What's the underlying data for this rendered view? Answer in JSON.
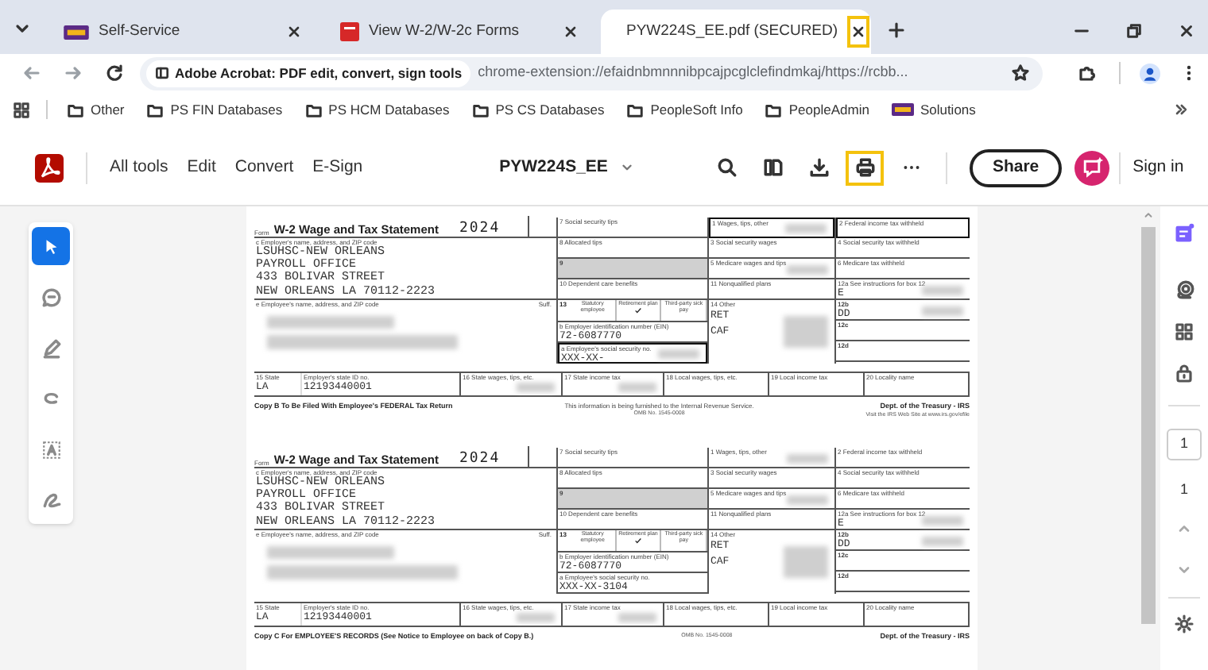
{
  "tabs": [
    {
      "label": "Self-Service",
      "kind": "logo",
      "selected": false,
      "close_highlighted": false
    },
    {
      "label": "View W-2/W-2c Forms",
      "kind": "red",
      "selected": false,
      "close_highlighted": false
    },
    {
      "label": "PYW224S_EE.pdf (SECURED)",
      "kind": "acrobat",
      "selected": true,
      "close_highlighted": true
    }
  ],
  "address_bar": {
    "site_chip": "Adobe Acrobat: PDF edit, convert, sign tools",
    "url": "chrome-extension://efaidnbmnnnibpcajpcglclefindmkaj/https://rcbb..."
  },
  "bookmarks": [
    {
      "label": "Other",
      "kind": "folder"
    },
    {
      "label": "PS FIN Databases",
      "kind": "folder"
    },
    {
      "label": "PS HCM Databases",
      "kind": "folder"
    },
    {
      "label": "PS CS Databases",
      "kind": "folder"
    },
    {
      "label": "PeopleSoft Info",
      "kind": "folder"
    },
    {
      "label": "PeopleAdmin",
      "kind": "folder"
    },
    {
      "label": "Solutions",
      "kind": "logo"
    }
  ],
  "acrobat_toolbar": {
    "menu": [
      "All tools",
      "Edit",
      "Convert",
      "E-Sign"
    ],
    "file_name": "PYW224S_EE",
    "tools": [
      {
        "kind": "search",
        "highlighted": false
      },
      {
        "kind": "pages",
        "highlighted": false
      },
      {
        "kind": "download",
        "highlighted": false
      },
      {
        "kind": "print",
        "highlighted": true
      },
      {
        "kind": "more",
        "highlighted": false
      }
    ],
    "share": "Share",
    "sign_in": "Sign in"
  },
  "left_tools": [
    {
      "kind": "select",
      "selected": true
    },
    {
      "kind": "comment",
      "selected": false
    },
    {
      "kind": "draw",
      "selected": false
    },
    {
      "kind": "lasso",
      "selected": false
    },
    {
      "kind": "text",
      "selected": false
    },
    {
      "kind": "sign",
      "selected": false
    }
  ],
  "right_rail": {
    "page_input": "1",
    "page_count": "1"
  },
  "forms": [
    {
      "form_prefix": "Form",
      "title": "W-2 Wage and Tax Statement",
      "year": "2024",
      "employer_label": "c Employer's name, address, and ZIP code",
      "employer_lines": [
        "LSUHSC-NEW ORLEANS",
        "PAYROLL OFFICE",
        "433 BOLIVAR STREET",
        "NEW ORLEANS LA 70112-2223"
      ],
      "employee_label": "e Employee's name, address, and ZIP code",
      "suffix_label": "Suff.",
      "columns": [
        [
          {
            "kind": "box",
            "label": "7 Social security tips",
            "outlined": false,
            "shaded": false,
            "redacted": false
          },
          {
            "kind": "box",
            "label": "8 Allocated tips",
            "outlined": false,
            "shaded": false,
            "redacted": false
          },
          {
            "kind": "box",
            "label": "9",
            "outlined": false,
            "shaded": true,
            "redacted": false
          },
          {
            "kind": "box",
            "label": "10 Dependent care benefits",
            "outlined": false,
            "shaded": false,
            "redacted": false
          },
          {
            "kind": "checks",
            "label": "13",
            "items": [
              {
                "label": "Statutory employee",
                "checked": false
              },
              {
                "label": "Retirement plan",
                "checked": true
              },
              {
                "label": "Third-party sick pay",
                "checked": false
              }
            ]
          },
          {
            "kind": "box",
            "label": "b Employer identification number (EIN)",
            "value": "72-6087770",
            "outlined": false,
            "shaded": false,
            "redacted": false
          },
          {
            "kind": "box",
            "label": "a Employee's social security no.",
            "value": "XXX-XX-",
            "outlined": true,
            "shaded": false,
            "redacted": true
          }
        ],
        [
          {
            "kind": "box",
            "label": "1 Wages, tips, other",
            "outlined": true,
            "shaded": false,
            "redacted": true
          },
          {
            "kind": "box",
            "label": "3 Social security wages",
            "outlined": false,
            "shaded": false,
            "redacted": false
          },
          {
            "kind": "box",
            "label": "5 Medicare wages and tips",
            "outlined": false,
            "shaded": false,
            "redacted": true
          },
          {
            "kind": "box",
            "label": "11 Nonqualified plans",
            "outlined": false,
            "shaded": false,
            "redacted": false
          },
          {
            "kind": "tall",
            "label": "14 Other",
            "lines": [
              "RET",
              "CAF"
            ],
            "redacted": true
          }
        ],
        [
          {
            "kind": "box",
            "label": "2 Federal income tax withheld",
            "outlined": true,
            "shaded": false,
            "redacted": false
          },
          {
            "kind": "box",
            "label": "4 Social security tax withheld",
            "outlined": false,
            "shaded": false,
            "redacted": false
          },
          {
            "kind": "box",
            "label": "6 Medicare tax withheld",
            "outlined": false,
            "shaded": false,
            "redacted": false
          },
          {
            "kind": "box",
            "label": "12a See instructions for box 12",
            "value": "E",
            "outlined": false,
            "shaded": false,
            "redacted": true
          },
          {
            "kind": "box",
            "label": "12b",
            "value": "DD",
            "outlined": false,
            "shaded": false,
            "redacted": true
          },
          {
            "kind": "box",
            "label": "12c",
            "outlined": false,
            "shaded": false,
            "redacted": false
          },
          {
            "kind": "box",
            "label": "12d",
            "outlined": false,
            "shaded": false,
            "redacted": false
          }
        ]
      ],
      "state_row": [
        {
          "label": "15 State",
          "value": "LA",
          "redacted": false
        },
        {
          "label": "Employer's state ID no.",
          "value": "12193440001",
          "redacted": false
        },
        {
          "label": "16 State wages, tips, etc.",
          "redacted": true
        },
        {
          "label": "17 State income tax",
          "redacted": true
        },
        {
          "label": "18 Local wages, tips, etc.",
          "redacted": false
        },
        {
          "label": "19 Local income tax",
          "redacted": false
        },
        {
          "label": "20 Locality name",
          "redacted": false
        }
      ],
      "footer": {
        "copy": "Copy B To Be Filed With Employee's FEDERAL Tax Return",
        "notice": "This information is being furnished to the Internal Revenue Service.",
        "omb": "OMB No. 1545-0008",
        "dept": "Dept. of the Treasury - IRS",
        "dept_note": "Visit the IRS Web Site at www.irs.gov/efile"
      }
    },
    {
      "form_prefix": "Form",
      "title": "W-2 Wage and Tax Statement",
      "year": "2024",
      "employer_label": "c Employer's name, address, and ZIP code",
      "employer_lines": [
        "LSUHSC-NEW ORLEANS",
        "PAYROLL OFFICE",
        "433 BOLIVAR STREET",
        "NEW ORLEANS LA 70112-2223"
      ],
      "employee_label": "e Employee's name, address, and ZIP code",
      "suffix_label": "Suff.",
      "columns": [
        [
          {
            "kind": "box",
            "label": "7 Social security tips",
            "outlined": false,
            "shaded": false,
            "redacted": false
          },
          {
            "kind": "box",
            "label": "8 Allocated tips",
            "outlined": false,
            "shaded": false,
            "redacted": false
          },
          {
            "kind": "box",
            "label": "9",
            "outlined": false,
            "shaded": true,
            "redacted": false
          },
          {
            "kind": "box",
            "label": "10 Dependent care benefits",
            "outlined": false,
            "shaded": false,
            "redacted": false
          },
          {
            "kind": "checks",
            "label": "13",
            "items": [
              {
                "label": "Statutory employee",
                "checked": false
              },
              {
                "label": "Retirement plan",
                "checked": true
              },
              {
                "label": "Third-party sick pay",
                "checked": false
              }
            ]
          },
          {
            "kind": "box",
            "label": "b Employer identification number (EIN)",
            "value": "72-6087770",
            "outlined": false,
            "shaded": false,
            "redacted": false
          },
          {
            "kind": "box",
            "label": "a Employee's social security no.",
            "value": "XXX-XX-3104",
            "outlined": false,
            "shaded": false,
            "redacted": false
          }
        ],
        [
          {
            "kind": "box",
            "label": "1 Wages, tips, other",
            "outlined": false,
            "shaded": false,
            "redacted": true
          },
          {
            "kind": "box",
            "label": "3 Social security wages",
            "outlined": false,
            "shaded": false,
            "redacted": false
          },
          {
            "kind": "box",
            "label": "5 Medicare wages and tips",
            "outlined": false,
            "shaded": false,
            "redacted": true
          },
          {
            "kind": "box",
            "label": "11 Nonqualified plans",
            "outlined": false,
            "shaded": false,
            "redacted": false
          },
          {
            "kind": "tall",
            "label": "14 Other",
            "lines": [
              "RET",
              "CAF"
            ],
            "redacted": true
          }
        ],
        [
          {
            "kind": "box",
            "label": "2 Federal income tax withheld",
            "outlined": false,
            "shaded": false,
            "redacted": false
          },
          {
            "kind": "box",
            "label": "4 Social security tax withheld",
            "outlined": false,
            "shaded": false,
            "redacted": false
          },
          {
            "kind": "box",
            "label": "6 Medicare tax withheld",
            "outlined": false,
            "shaded": false,
            "redacted": false
          },
          {
            "kind": "box",
            "label": "12a See instructions for box 12",
            "value": "E",
            "outlined": false,
            "shaded": false,
            "redacted": true
          },
          {
            "kind": "box",
            "label": "12b",
            "value": "DD",
            "outlined": false,
            "shaded": false,
            "redacted": true
          },
          {
            "kind": "box",
            "label": "12c",
            "outlined": false,
            "shaded": false,
            "redacted": false
          },
          {
            "kind": "box",
            "label": "12d",
            "outlined": false,
            "shaded": false,
            "redacted": false
          }
        ]
      ],
      "state_row": [
        {
          "label": "15 State",
          "value": "LA",
          "redacted": false
        },
        {
          "label": "Employer's state ID no.",
          "value": "12193440001",
          "redacted": false
        },
        {
          "label": "16 State wages, tips, etc.",
          "redacted": true
        },
        {
          "label": "17 State income tax",
          "redacted": true
        },
        {
          "label": "18 Local wages, tips, etc.",
          "redacted": false
        },
        {
          "label": "19 Local income tax",
          "redacted": false
        },
        {
          "label": "20 Locality name",
          "redacted": false
        }
      ],
      "footer": {
        "copy": "Copy C For EMPLOYEE'S RECORDS (See Notice to Employee on back of Copy B.)",
        "omb": "OMB No. 1545-0008",
        "dept": "Dept. of the Treasury - IRS"
      }
    }
  ]
}
